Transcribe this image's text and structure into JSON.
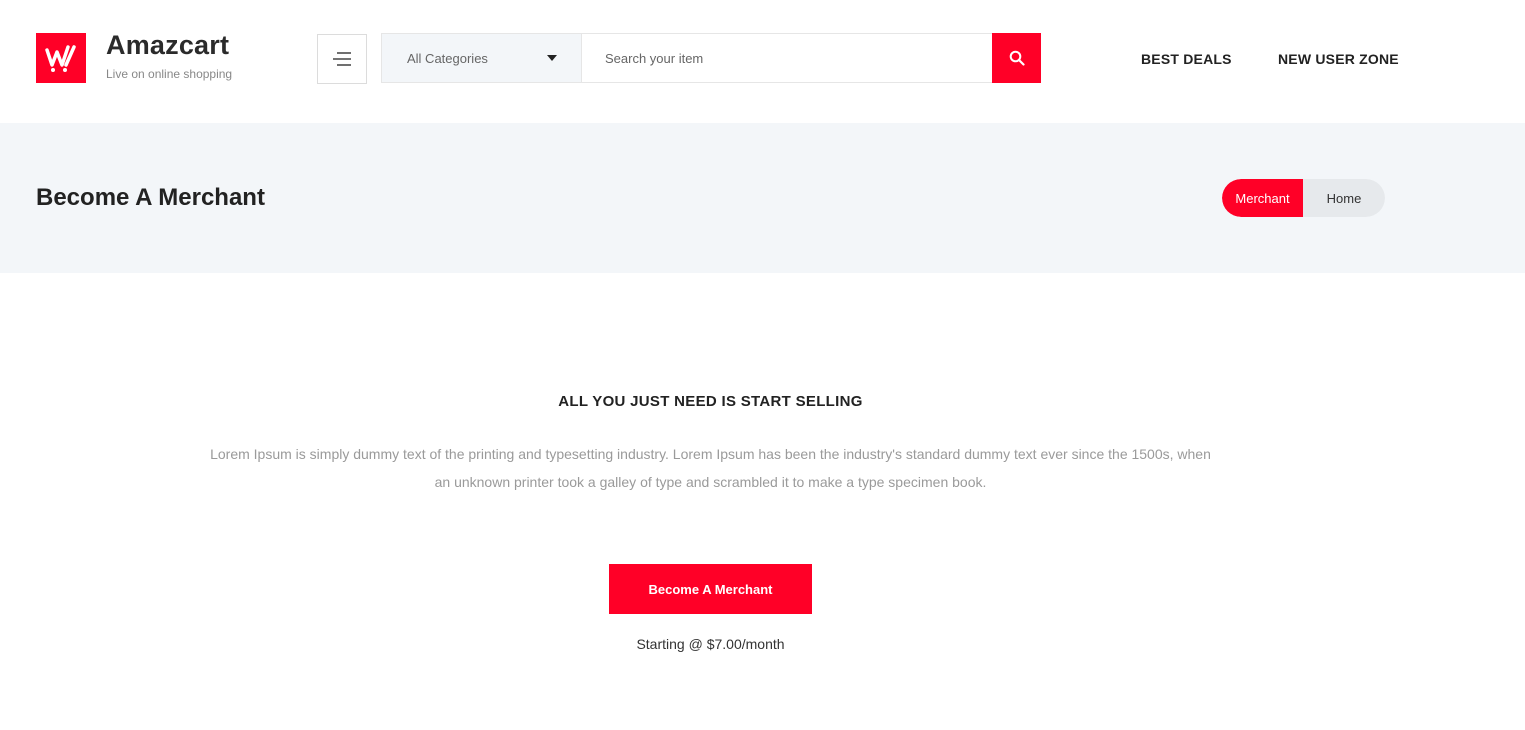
{
  "brand": {
    "name": "Amazcart",
    "tagline": "Live on online shopping",
    "logo_icon": "shopping-cart-logo-icon",
    "accent_color": "#ff0027"
  },
  "header": {
    "menu_icon": "hamburger-menu-icon",
    "search": {
      "category_selected": "All Categories",
      "placeholder": "Search your item",
      "value": "",
      "button_icon": "search-icon"
    },
    "nav": [
      {
        "label": "BEST DEALS"
      },
      {
        "label": "NEW USER ZONE"
      }
    ]
  },
  "banner": {
    "title": "Become A Merchant",
    "breadcrumb": {
      "active": "Merchant",
      "home": "Home"
    },
    "background_color": "#f3f6f9"
  },
  "main": {
    "heading": "ALL YOU JUST NEED IS START SELLING",
    "description": "Lorem Ipsum is simply dummy text of the printing and typesetting industry. Lorem Ipsum has been the industry's standard dummy text ever since the 1500s, when an unknown printer took a galley of type and scrambled it to make a type specimen book.",
    "cta_label": "Become A Merchant",
    "price_note": "Starting @ $7.00/month"
  }
}
